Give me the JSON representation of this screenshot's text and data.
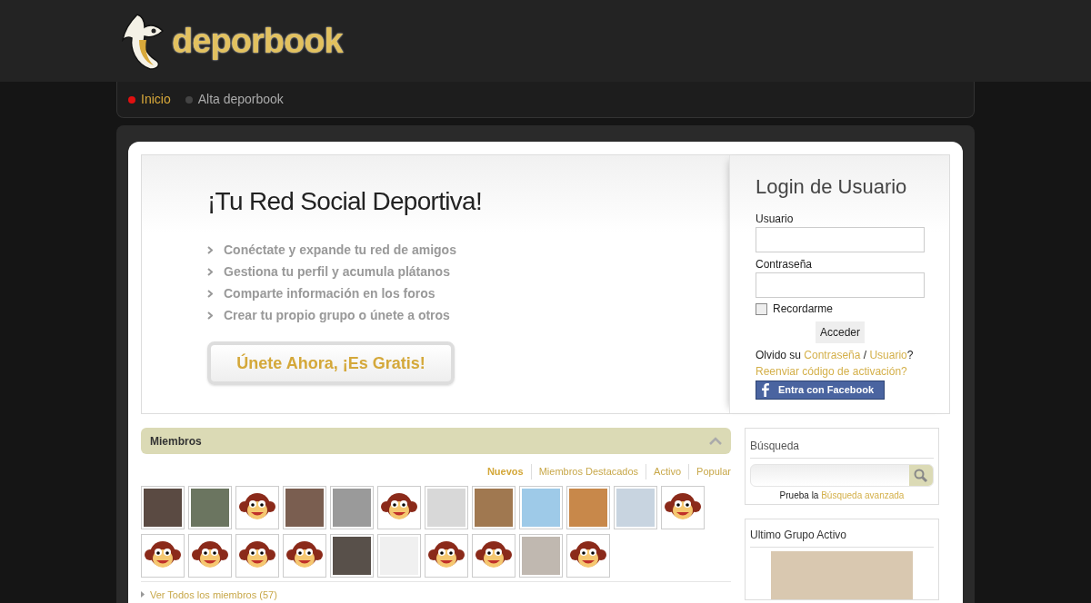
{
  "header": {
    "logo_text": "deporbook"
  },
  "nav": [
    {
      "label": "Inicio",
      "selected": true
    },
    {
      "label": "Alta deporbook",
      "selected": false
    }
  ],
  "hero": {
    "title": "¡Tu Red Social Deportiva!",
    "features": [
      "Conéctate y expande tu red de amigos",
      "Gestiona tu perfil y acumula plátanos",
      "Comparte información en los foros",
      "Crear tu propio grupo o únete a otros"
    ],
    "cta": "Únete Ahora, ¡Es Gratis!"
  },
  "login": {
    "title": "Login de Usuario",
    "username_label": "Usuario",
    "password_label": "Contraseña",
    "remember": {
      "label": "Recordarme",
      "checked": false
    },
    "submit": "Acceder",
    "forgot_prefix": "Olvido su",
    "forgot_password": "Contraseña",
    "forgot_sep": "/",
    "forgot_user": "Usuario",
    "forgot_suffix": "?",
    "resend": "Reenviar código de activación?",
    "facebook": "Entra con Facebook"
  },
  "members": {
    "title": "Miembros",
    "tabs": [
      {
        "label": "Nuevos",
        "selected": true
      },
      {
        "label": "Miembros Destacados",
        "selected": false
      },
      {
        "label": "Activo",
        "selected": false
      },
      {
        "label": "Popular",
        "selected": false
      }
    ],
    "avatars": [
      {
        "kind": "photo"
      },
      {
        "kind": "photo"
      },
      {
        "kind": "monkey"
      },
      {
        "kind": "photo"
      },
      {
        "kind": "photo"
      },
      {
        "kind": "monkey"
      },
      {
        "kind": "photo"
      },
      {
        "kind": "photo"
      },
      {
        "kind": "photo"
      },
      {
        "kind": "photo"
      },
      {
        "kind": "photo"
      },
      {
        "kind": "monkey"
      },
      {
        "kind": "monkey"
      },
      {
        "kind": "monkey"
      },
      {
        "kind": "monkey"
      },
      {
        "kind": "monkey"
      },
      {
        "kind": "photo"
      },
      {
        "kind": "photo"
      },
      {
        "kind": "monkey"
      },
      {
        "kind": "monkey"
      },
      {
        "kind": "photo"
      },
      {
        "kind": "monkey"
      }
    ],
    "see_all": "Ver Todos los miembros (57)"
  },
  "search": {
    "title": "Búsqueda",
    "hint_prefix": "Prueba la",
    "hint_link": "Búsqueda avanzada"
  },
  "group": {
    "title": "Ultimo Grupo Activo"
  }
}
